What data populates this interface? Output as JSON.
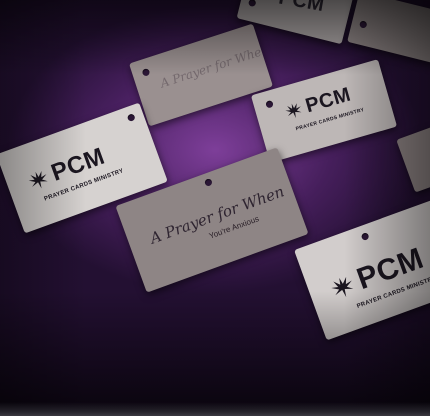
{
  "brand": {
    "name": "PCM",
    "tagline": "PRAYER CARDS MINISTRY"
  },
  "card_center": {
    "script_line": "A Prayer for When",
    "sub_line": "You're Anxious"
  },
  "colors": {
    "surface": "#4a2260",
    "card": "#cfcac8",
    "ink": "#1b1620"
  },
  "icons": {
    "logo_mark": "praying-hands-sunburst-icon"
  }
}
